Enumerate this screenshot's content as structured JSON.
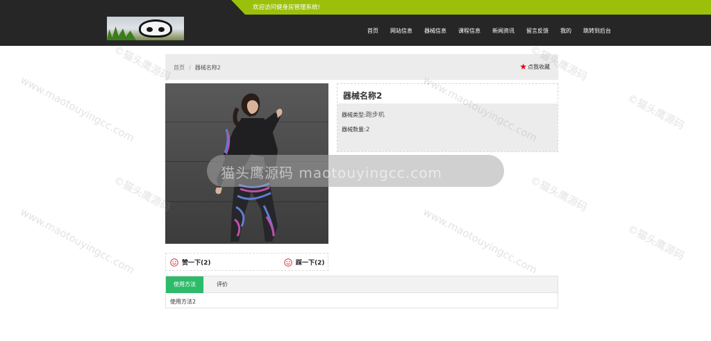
{
  "header": {
    "welcome": "欢迎访问健身房管理系统!",
    "nav": [
      "首页",
      "网站信息",
      "器械信息",
      "课程信息",
      "新闻资讯",
      "留言反馈",
      "我的",
      "跳转到后台"
    ]
  },
  "breadcrumb": {
    "home": "首页",
    "separator": "/",
    "current": "器械名称2"
  },
  "favorite": {
    "label": "点我收藏",
    "icon": "star-icon",
    "color": "#e60012"
  },
  "product": {
    "title": "器械名称2",
    "type_label": "器械类型:",
    "type_value": "跑步机",
    "count_label": "器械数量:",
    "count_value": "2"
  },
  "votes": {
    "like": "赞一下(2)",
    "dislike": "踩一下(2)"
  },
  "tabs": {
    "items": [
      "使用方法",
      "评价"
    ],
    "active_color": "#2dbb6a",
    "content": "使用方法2"
  },
  "watermark": {
    "main": "猫头鹰源码 maotouyingcc.com",
    "tile_cn": "©猫头鹰源码",
    "tile_en": "www.maotouyingcc.com"
  },
  "colors": {
    "header_bg": "#262626",
    "accent_green": "#9bc00a"
  }
}
